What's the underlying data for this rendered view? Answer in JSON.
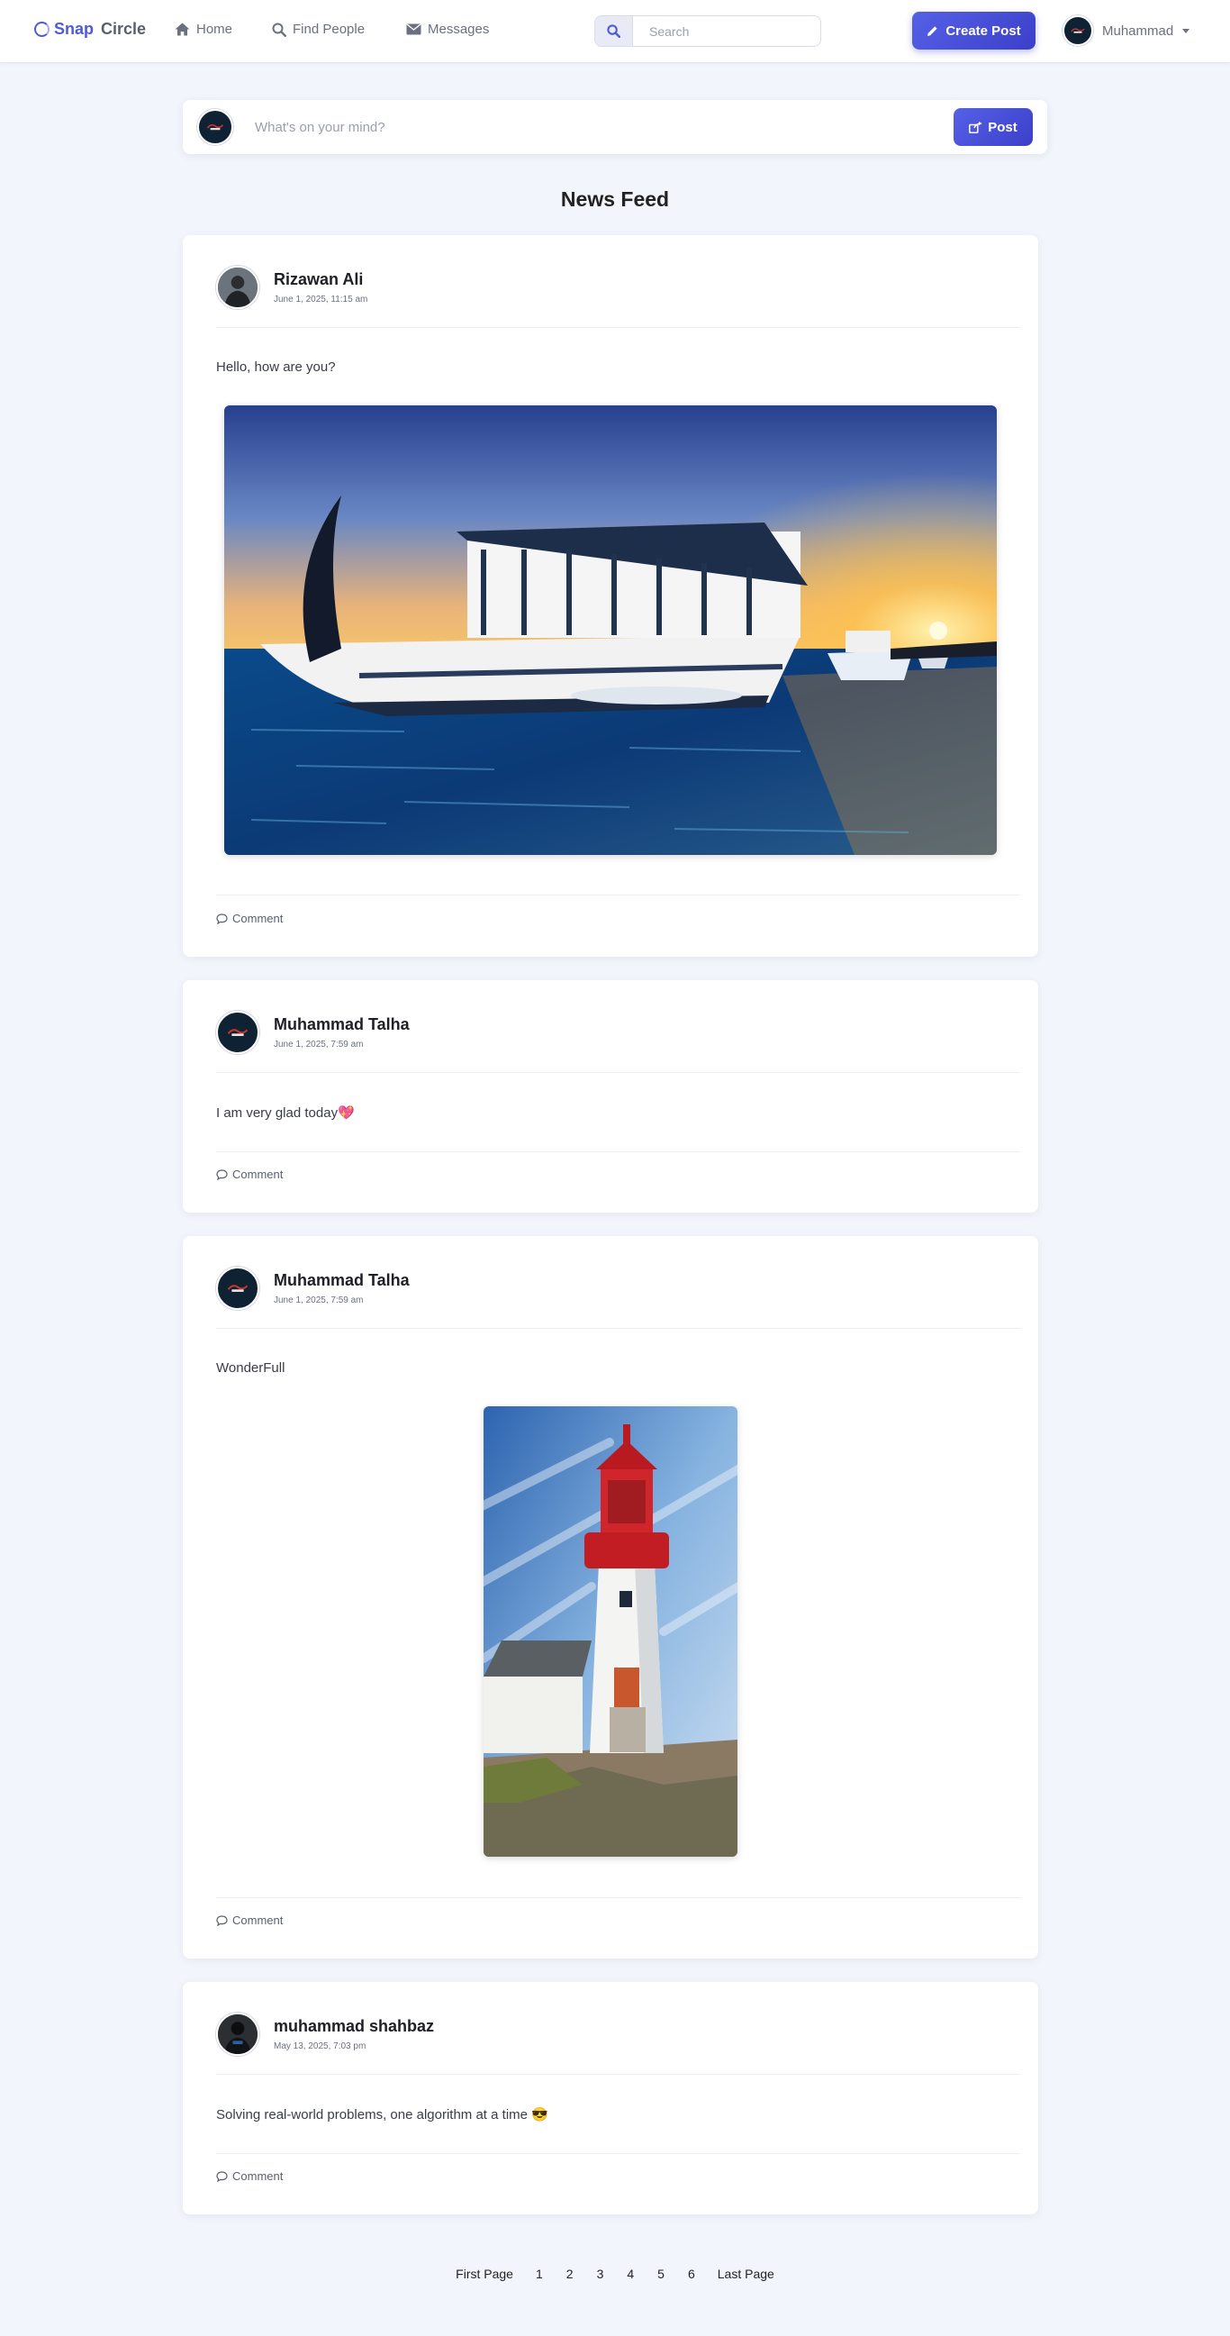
{
  "brand": {
    "snap": "Snap",
    "circle": "Circle"
  },
  "nav": {
    "home": "Home",
    "find_people": "Find People",
    "messages": "Messages"
  },
  "search": {
    "placeholder": "Search"
  },
  "header": {
    "create_post": "Create Post",
    "user_name": "Muhammad"
  },
  "composer": {
    "placeholder": "What's on your mind?",
    "post_label": "Post"
  },
  "feed": {
    "title": "News Feed",
    "posts": [
      {
        "author": "Rizawan Ali",
        "timestamp": "June 1, 2025, 11:15 am",
        "text": "Hello, how are you?",
        "image": "boat-sunset",
        "comment_label": "Comment"
      },
      {
        "author": "Muhammad Talha",
        "timestamp": "June 1, 2025, 7:59 am",
        "text": "I am very glad today💖",
        "image": null,
        "comment_label": "Comment"
      },
      {
        "author": "Muhammad Talha",
        "timestamp": "June 1, 2025, 7:59 am",
        "text": "WonderFull",
        "image": "lighthouse",
        "comment_label": "Comment"
      },
      {
        "author": "muhammad shahbaz",
        "timestamp": "May 13, 2025, 7:03 pm",
        "text": "Solving real-world problems, one algorithm at a time 😎",
        "image": null,
        "comment_label": "Comment"
      }
    ]
  },
  "pagination": {
    "first": "First Page",
    "pages": [
      "1",
      "2",
      "3",
      "4",
      "5",
      "6"
    ],
    "last": "Last Page"
  },
  "colors": {
    "accent": "#4f5bd5",
    "background": "#f2f5fc"
  }
}
